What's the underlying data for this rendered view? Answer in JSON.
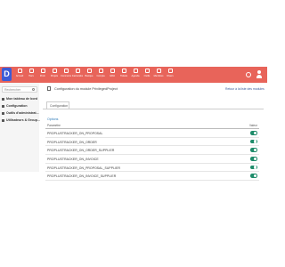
{
  "app": {
    "logo_letter": "D",
    "menu": [
      "Accueil",
      "Tiers",
      "Prod.",
      "Projets",
      "Commerce",
      "Facturation",
      "Banque",
      "Compta",
      "GRH",
      "Tickets",
      "Agenda",
      "Outils",
      "Membres",
      "Divers"
    ]
  },
  "sidebar": {
    "search_placeholder": "Rechercher",
    "items": [
      {
        "label": "Mon tableau de bord"
      },
      {
        "label": "Configuration"
      },
      {
        "label": "Outils d'administrat..."
      },
      {
        "label": "Utilisateurs & Group..."
      }
    ]
  },
  "page": {
    "title": "Configuration du module PrivilegedProject",
    "back_link": "Retour à la liste des modules",
    "tab_label": "Configuration",
    "section_title": "Options"
  },
  "table": {
    "headers": [
      "Paramètre",
      "Valeur"
    ],
    "rows": [
      {
        "name": "PROPLUSTRACKER_ON_PROPOSAL",
        "enabled": true
      },
      {
        "name": "PROPLUSTRACKER_ON_ORDER",
        "enabled": true
      },
      {
        "name": "PROPLUSTRACKER_ON_ORDER_SUPPLIER",
        "enabled": true
      },
      {
        "name": "PROPLUSTRACKER_ON_INVOICE",
        "enabled": true
      },
      {
        "name": "PROPLUSTRACKER_ON_PROPOSAL_SUPPLIER",
        "enabled": true
      },
      {
        "name": "PROPLUSTRACKER_ON_INVOICE_SUPPLIER",
        "enabled": true
      }
    ]
  },
  "colors": {
    "topbar": "#e8645a",
    "logo": "#3c5bd6",
    "toggle_on": "#1e8c6a",
    "link": "#2d7ab8"
  }
}
